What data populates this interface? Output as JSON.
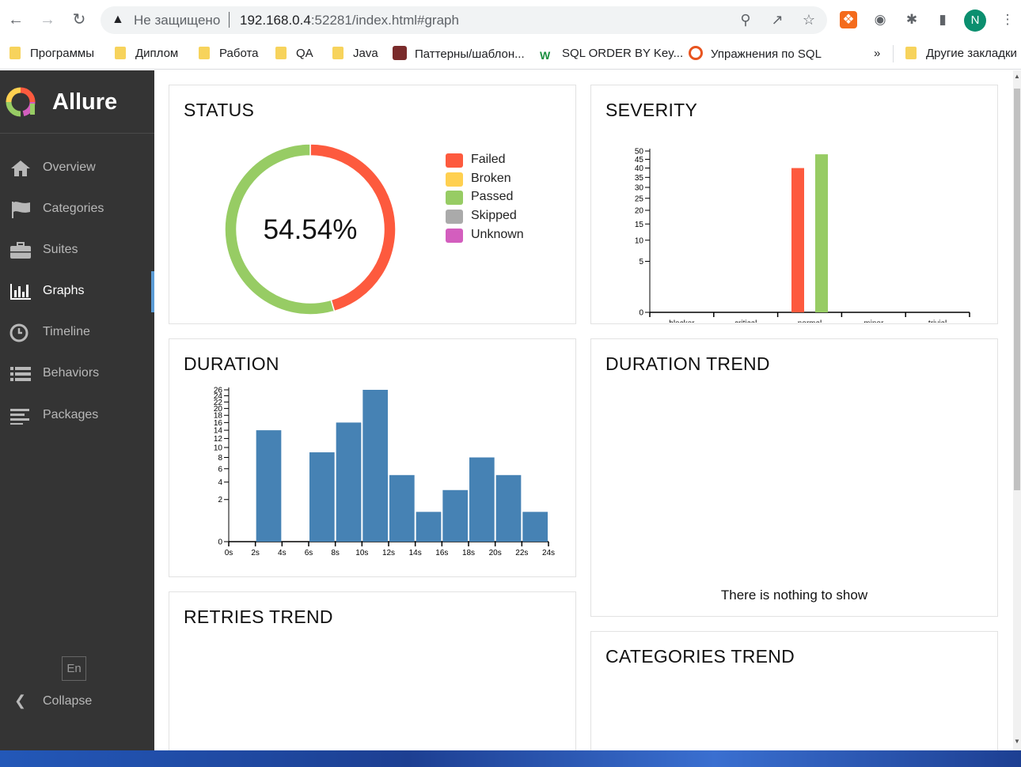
{
  "browser": {
    "security_label": "Не защищено",
    "url_host": "192.168.0.4",
    "url_path": ":52281/index.html#graph",
    "avatar_letter": "N",
    "bookmarks": [
      {
        "label": "Программы",
        "icon": "folder-icon"
      },
      {
        "label": "Диплом",
        "icon": "folder-icon"
      },
      {
        "label": "Работа",
        "icon": "folder-icon"
      },
      {
        "label": "QA",
        "icon": "folder-icon"
      },
      {
        "label": "Java",
        "icon": "folder-icon"
      },
      {
        "label": "Паттерны/шаблон...",
        "icon": "site-icon"
      },
      {
        "label": "SQL ORDER BY Key...",
        "icon": "w3-icon"
      },
      {
        "label": "Упражнения по SQL",
        "icon": "target-icon"
      }
    ],
    "more_bookmarks": "»",
    "other_bookmarks": "Другие закладки"
  },
  "sidebar": {
    "brand": "Allure",
    "items": [
      {
        "label": "Overview",
        "icon": "home-icon"
      },
      {
        "label": "Categories",
        "icon": "flag-icon"
      },
      {
        "label": "Suites",
        "icon": "briefcase-icon"
      },
      {
        "label": "Graphs",
        "icon": "bar-chart-icon",
        "active": true
      },
      {
        "label": "Timeline",
        "icon": "clock-icon"
      },
      {
        "label": "Behaviors",
        "icon": "list-icon"
      },
      {
        "label": "Packages",
        "icon": "align-left-icon"
      }
    ],
    "language": "En",
    "collapse_label": "Collapse"
  },
  "cards": {
    "status_title": "STATUS",
    "severity_title": "SEVERITY",
    "duration_title": "DURATION",
    "duration_trend_title": "DURATION TREND",
    "duration_trend_empty": "There is nothing to show",
    "retries_trend_title": "RETRIES TREND",
    "categories_trend_title": "CATEGORIES TREND"
  },
  "colors": {
    "failed": "#fd5a3e",
    "broken": "#ffd050",
    "passed": "#97cc64",
    "skipped": "#aaaaaa",
    "unknown": "#d35ebe",
    "duration_bar": "#4682b4"
  },
  "chart_data": [
    {
      "type": "pie",
      "title": "STATUS",
      "center_label": "54.54%",
      "labels": [
        "Failed",
        "Broken",
        "Passed",
        "Skipped",
        "Unknown"
      ],
      "values": [
        40,
        0,
        48,
        0,
        0
      ],
      "legend_position": "right"
    },
    {
      "type": "bar",
      "title": "SEVERITY",
      "categories": [
        "blocker",
        "critical",
        "normal",
        "minor",
        "trivial"
      ],
      "series": [
        {
          "name": "Failed",
          "values": [
            0,
            0,
            40,
            0,
            0
          ]
        },
        {
          "name": "Passed",
          "values": [
            0,
            0,
            48,
            0,
            0
          ]
        }
      ],
      "yscale": "sqrt",
      "yticks": [
        0,
        5,
        10,
        15,
        20,
        25,
        30,
        35,
        40,
        45,
        50
      ],
      "ylim": [
        0,
        50
      ]
    },
    {
      "type": "bar",
      "title": "DURATION",
      "x_ticks": [
        "0s",
        "2s",
        "4s",
        "6s",
        "8s",
        "10s",
        "12s",
        "14s",
        "16s",
        "18s",
        "20s",
        "22s",
        "24s"
      ],
      "bins": [
        {
          "from": 2,
          "to": 4,
          "value": 14
        },
        {
          "from": 6,
          "to": 8,
          "value": 9
        },
        {
          "from": 8,
          "to": 10,
          "value": 16
        },
        {
          "from": 10,
          "to": 12,
          "value": 26
        },
        {
          "from": 12,
          "to": 14,
          "value": 5
        },
        {
          "from": 14,
          "to": 16,
          "value": 1
        },
        {
          "from": 16,
          "to": 18,
          "value": 3
        },
        {
          "from": 18,
          "to": 20,
          "value": 8
        },
        {
          "from": 20,
          "to": 22,
          "value": 5
        },
        {
          "from": 22,
          "to": 24,
          "value": 1
        }
      ],
      "yscale": "sqrt",
      "yticks": [
        0,
        2,
        4,
        6,
        8,
        10,
        12,
        14,
        16,
        18,
        20,
        22,
        24,
        26
      ],
      "ylim": [
        0,
        26
      ],
      "xlim": [
        0,
        24
      ]
    }
  ]
}
